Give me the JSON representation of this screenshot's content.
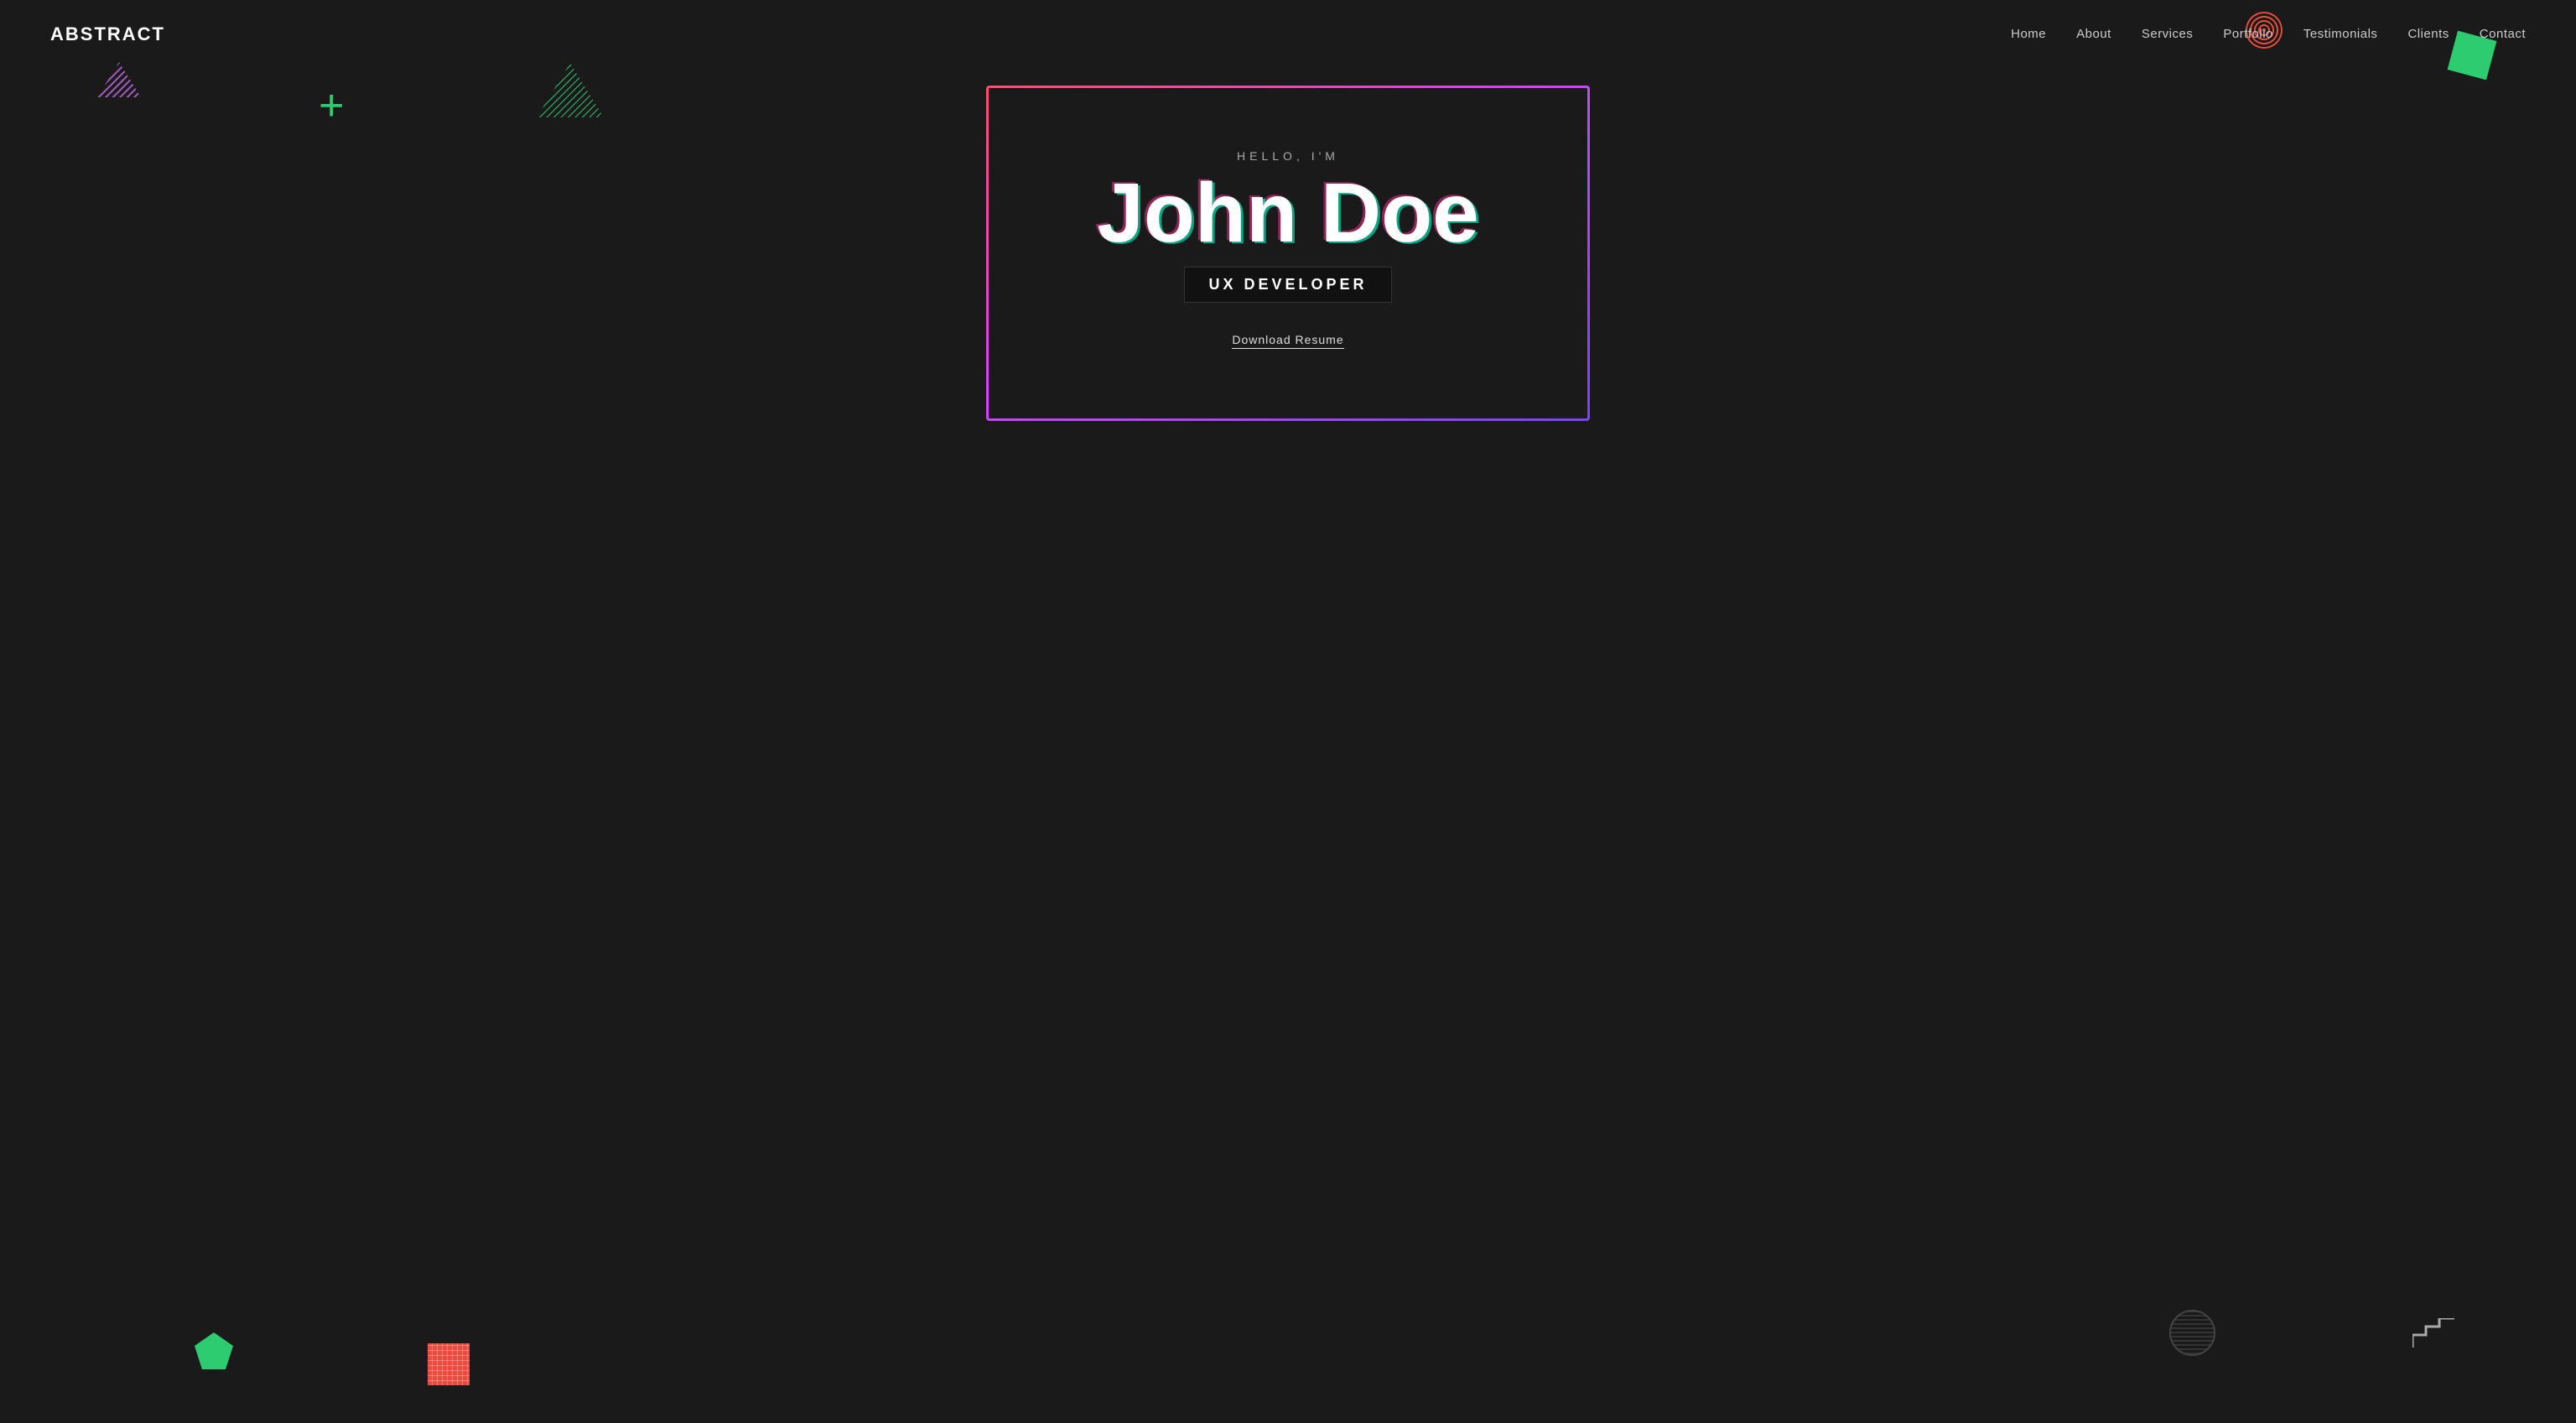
{
  "brand": {
    "logo": "ABSTRACT"
  },
  "nav": {
    "links": [
      {
        "label": "Home",
        "href": "#home"
      },
      {
        "label": "About",
        "href": "#about"
      },
      {
        "label": "Services",
        "href": "#services"
      },
      {
        "label": "Portfolio",
        "href": "#portfolio"
      },
      {
        "label": "Testimonials",
        "href": "#testimonials"
      },
      {
        "label": "Clients",
        "href": "#clients"
      },
      {
        "label": "Contact",
        "href": "#contact"
      }
    ]
  },
  "hero": {
    "greeting": "HELLO, I'M",
    "name": "John Doe",
    "title": "UX DEVELOPER",
    "cta": "Download Resume"
  },
  "shapes": {
    "plus_symbol": "+",
    "stair_symbol": "⌐",
    "triangle_color": "#2ecc71",
    "green_accent": "#2ecc71",
    "pink_accent": "#ff4d6d",
    "purple_accent": "#9b59b6"
  }
}
